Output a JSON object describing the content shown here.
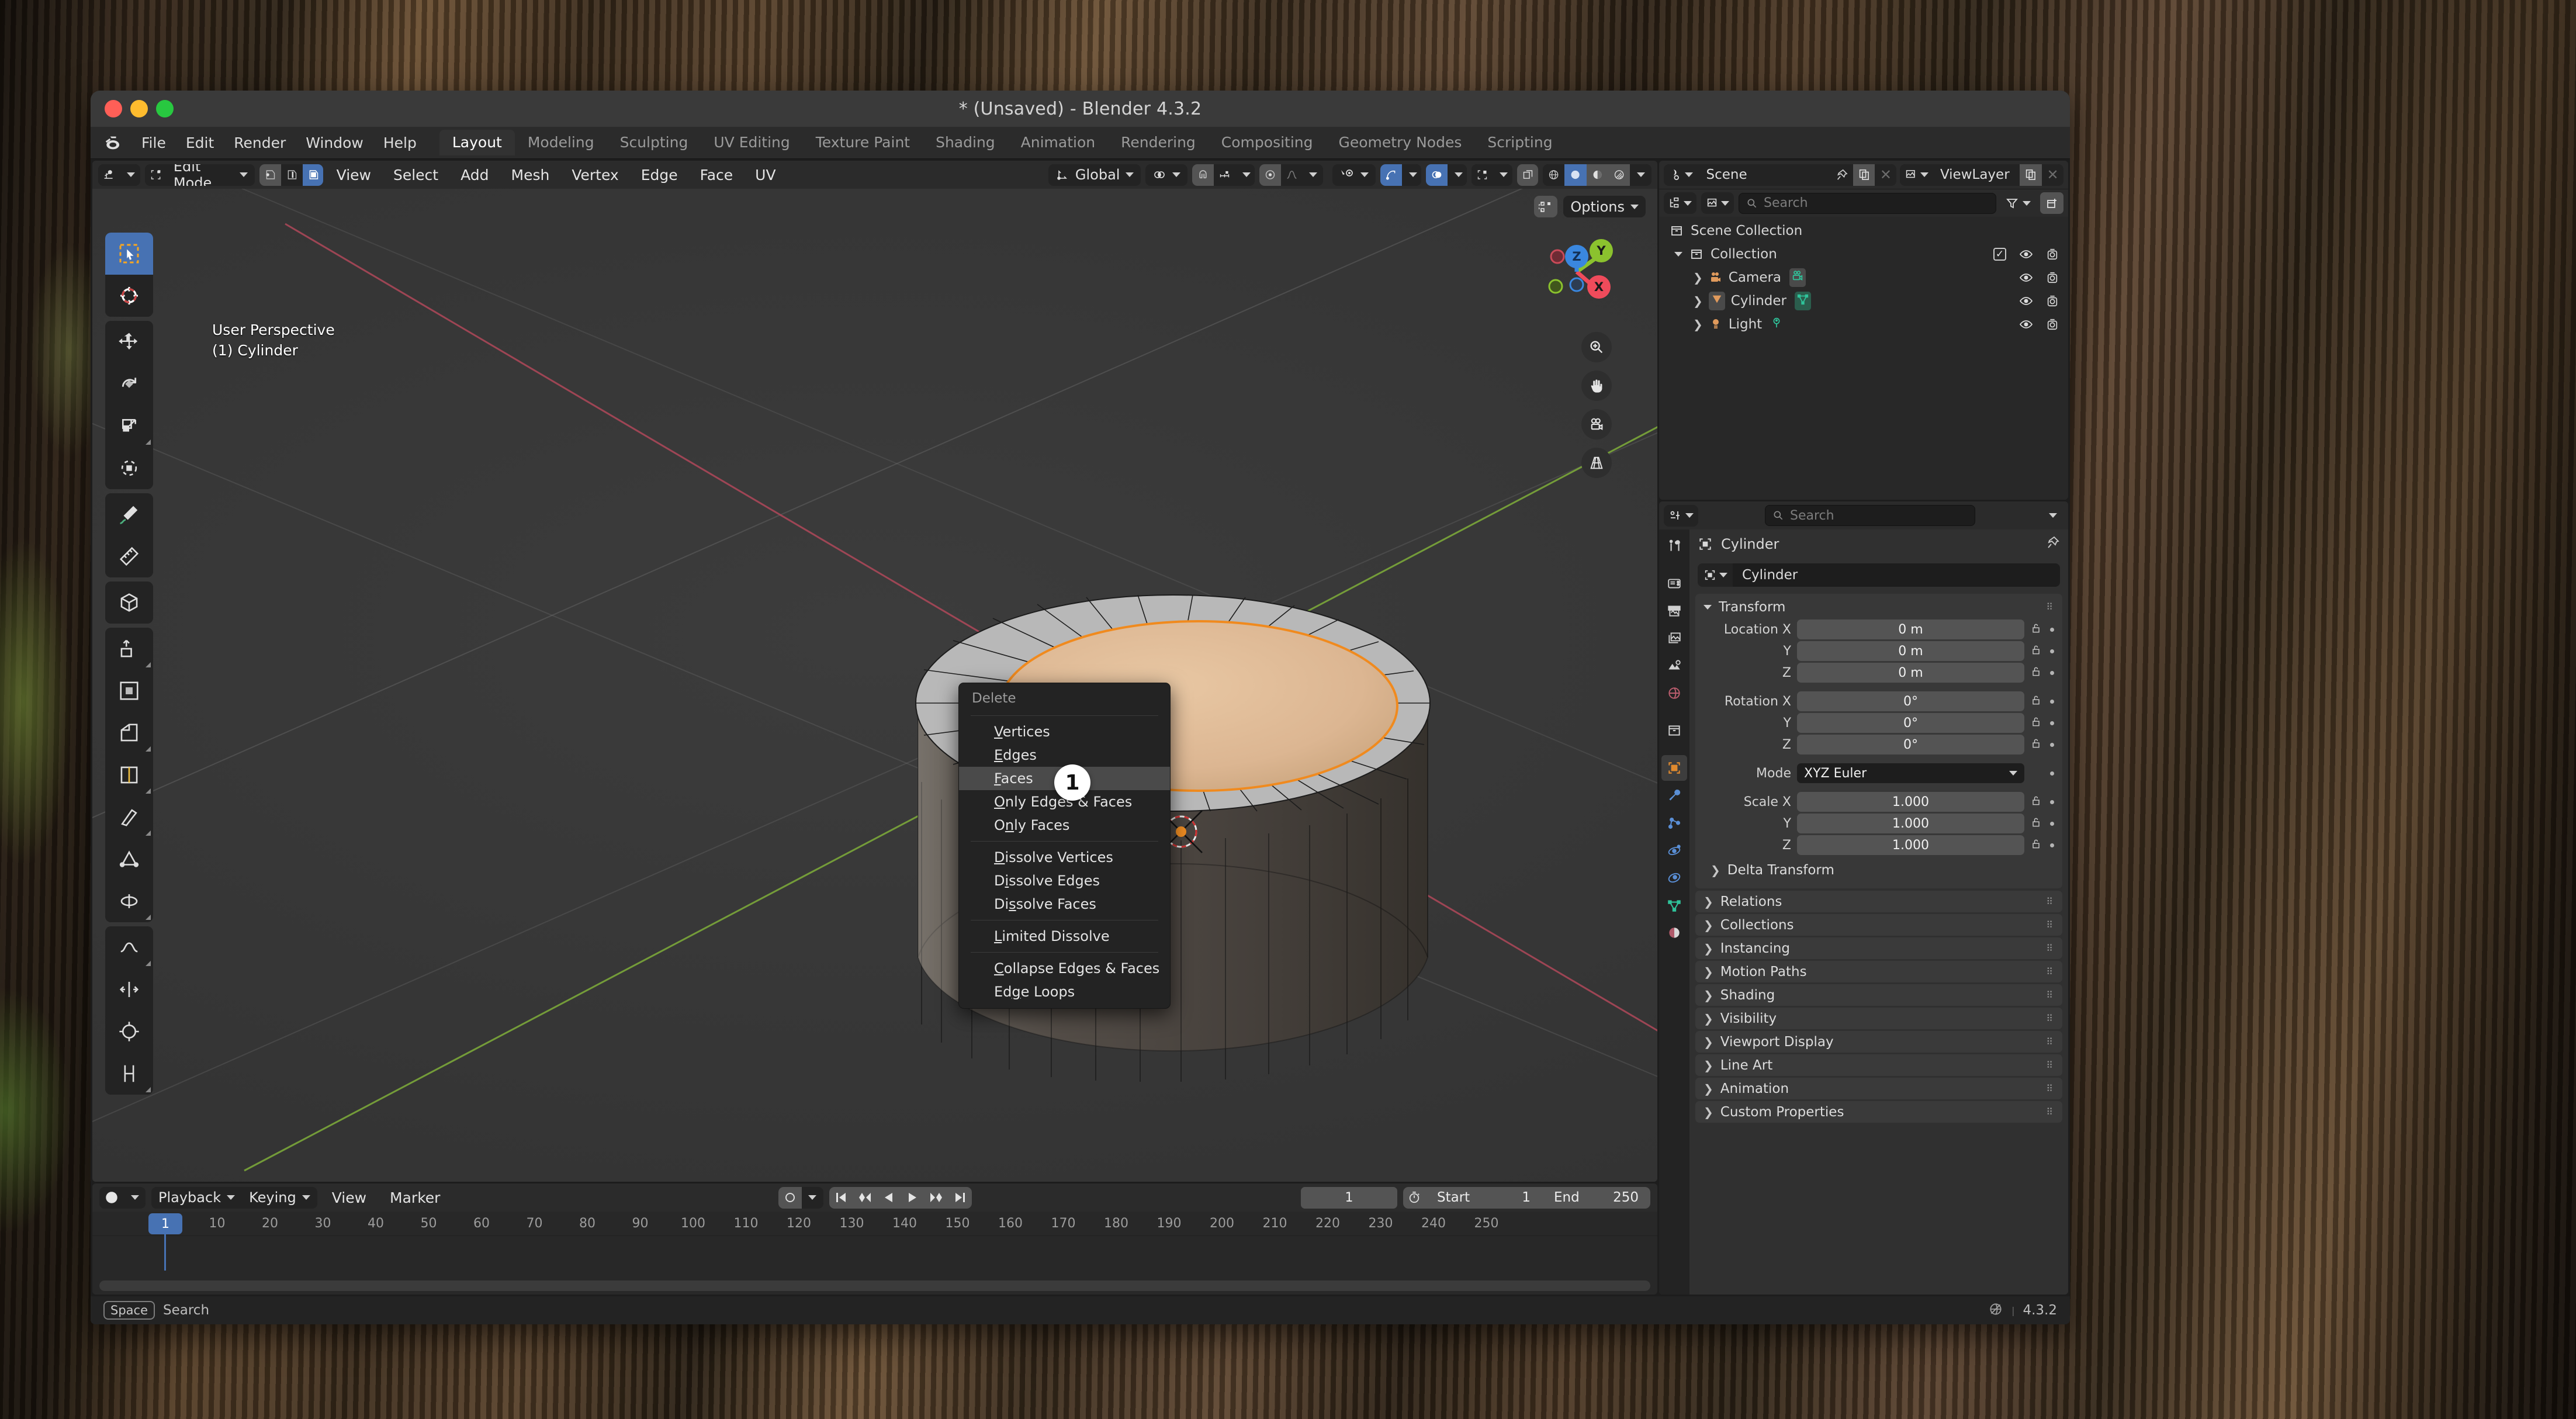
{
  "window": {
    "title": "* (Unsaved) - Blender 4.3.2",
    "traffic": {
      "close": "#ff5f57",
      "minimize": "#febc2e",
      "zoom": "#28c840"
    }
  },
  "topbar": {
    "logo": "blender-logo-icon",
    "menus": [
      "File",
      "Edit",
      "Render",
      "Window",
      "Help"
    ],
    "workspaces": [
      "Layout",
      "Modeling",
      "Sculpting",
      "UV Editing",
      "Texture Paint",
      "Shading",
      "Animation",
      "Rendering",
      "Compositing",
      "Geometry Nodes",
      "Scripting"
    ],
    "active_workspace": "Layout"
  },
  "viewport": {
    "editor_type_icon": "editor-type-3dview-icon",
    "mode": "Edit Mode",
    "select_modes": [
      "vertex-select-icon",
      "edge-select-icon",
      "face-select-icon"
    ],
    "active_select_mode": "face-select-icon",
    "menus": [
      "View",
      "Select",
      "Add",
      "Mesh",
      "Vertex",
      "Edge",
      "Face",
      "UV"
    ],
    "transform_orientation": "Global",
    "pivot_icon": "pivot-point-icon",
    "snap_icon": "magnet-icon",
    "snap_target_icon": "snap-increment-icon",
    "proportional_icon": "proportional-editing-icon",
    "falloff_icon": "smooth-falloff-icon",
    "options_label": "Options",
    "mesh_edit_mode_icon": "mesh-edit-options-icon",
    "overlay_line1": "User Perspective",
    "overlay_line2": "(1) Cylinder",
    "gizmo_axes": [
      {
        "label": "Z",
        "color": "#3a87df"
      },
      {
        "label": "Y",
        "color": "#8bc22e"
      },
      {
        "label": "X",
        "color": "#ef4b5b"
      }
    ],
    "nav_icons": [
      "zoom-icon",
      "pan-hand-icon",
      "camera-view-icon",
      "toggle-perspective-icon"
    ],
    "right_header_icons": [
      "visibility-selectability-icon",
      "gizmos-icon",
      "overlays-icon",
      "xray-toggle-icon",
      "shading-wireframe-icon",
      "shading-solid-icon",
      "shading-material-icon",
      "shading-rendered-icon"
    ],
    "toolbar_tools": [
      "tweak-select-box-icon",
      "cursor-icon",
      "move-icon",
      "rotate-icon",
      "scale-icon",
      "transform-icon",
      "annotate-icon",
      "measure-icon",
      "add-cube-icon",
      "extrude-region-icon",
      "inset-faces-icon",
      "bevel-icon",
      "loop-cut-icon",
      "knife-icon",
      "poly-build-icon",
      "spin-icon",
      "smooth-icon",
      "edge-slide-icon",
      "shrink-fatten-icon",
      "shear-icon",
      "rip-region-icon"
    ],
    "active_tool": "tweak-select-box-icon"
  },
  "delete_menu": {
    "title": "Delete",
    "highlighted": "Faces",
    "groups": [
      [
        {
          "label": "Vertices",
          "accel": "V"
        },
        {
          "label": "Edges",
          "accel": "E"
        },
        {
          "label": "Faces",
          "accel": "F"
        },
        {
          "label": "Only Edges & Faces",
          "accel": "O"
        },
        {
          "label": "Only Faces",
          "accel": "n"
        }
      ],
      [
        {
          "label": "Dissolve Vertices",
          "accel": "D"
        },
        {
          "label": "Dissolve Edges",
          "accel": "i"
        },
        {
          "label": "Dissolve Faces",
          "accel": "s"
        }
      ],
      [
        {
          "label": "Limited Dissolve",
          "accel": "L"
        }
      ],
      [
        {
          "label": "Collapse Edges & Faces",
          "accel": "C"
        },
        {
          "label": "Edge Loops",
          "accel": "g"
        }
      ]
    ],
    "step_badge": "1"
  },
  "outliner": {
    "scene_icon": "scene-icon",
    "scene_name": "Scene",
    "pin_icon": "pin-icon",
    "copy_icon": "new-scene-icon",
    "close_icon": "unlink-icon",
    "viewlayer_icon": "view-layer-icon",
    "viewlayer_name": "ViewLayer",
    "display_mode_icon": "outliner-display-mode-icon",
    "filter_icon": "filter-funnel-icon",
    "new_collection_icon": "new-collection-icon",
    "search_placeholder": "Search",
    "rows": [
      {
        "label": "Scene Collection",
        "icon": "collection-icon",
        "indent": 0,
        "expand": "",
        "checkbox": false,
        "eye": false,
        "camera": false
      },
      {
        "label": "Collection",
        "icon": "collection-icon",
        "indent": 1,
        "expand": "down",
        "checkbox": true,
        "eye": true,
        "camera": true
      },
      {
        "label": "Camera",
        "icon": "camera-data-icon",
        "indent": 2,
        "expand": "right",
        "data_icon": "camera-object-icon",
        "eye": true,
        "camera": true
      },
      {
        "label": "Cylinder",
        "icon": "mesh-object-icon",
        "indent": 2,
        "expand": "right",
        "data_icon": "mesh-data-icon",
        "eye": true,
        "camera": true
      },
      {
        "label": "Light",
        "icon": "light-object-icon",
        "indent": 2,
        "expand": "right",
        "data_icon": "light-data-icon",
        "eye": true,
        "camera": true
      }
    ]
  },
  "properties": {
    "editor_icon": "properties-editor-icon",
    "search_placeholder": "Search",
    "breadcrumb_icon": "object-properties-icon",
    "breadcrumb": "Cylinder",
    "pin_icon": "pin-icon",
    "name_field_icon": "object-properties-icon",
    "name_field_value": "Cylinder",
    "tabs": [
      "tool-icon",
      "render-icon",
      "output-icon",
      "view-layer-icon",
      "scene-icon",
      "world-icon",
      "collection-icon",
      "object-icon",
      "modifiers-icon",
      "particles-icon",
      "physics-icon",
      "object-constraints-icon",
      "object-data-icon",
      "material-icon"
    ],
    "active_tab": "object-icon",
    "transform": {
      "title": "Transform",
      "rows": [
        {
          "label": "Location X",
          "value": "0 m"
        },
        {
          "label": "Y",
          "value": "0 m"
        },
        {
          "label": "Z",
          "value": "0 m"
        },
        {
          "label": "Rotation X",
          "value": "0°"
        },
        {
          "label": "Y",
          "value": "0°"
        },
        {
          "label": "Z",
          "value": "0°"
        }
      ],
      "mode_label": "Mode",
      "mode_value": "XYZ Euler",
      "scale_rows": [
        {
          "label": "Scale X",
          "value": "1.000"
        },
        {
          "label": "Y",
          "value": "1.000"
        },
        {
          "label": "Z",
          "value": "1.000"
        }
      ]
    },
    "closed_panels": [
      "Delta Transform",
      "Relations",
      "Collections",
      "Instancing",
      "Motion Paths",
      "Shading",
      "Visibility",
      "Viewport Display",
      "Line Art",
      "Animation",
      "Custom Properties"
    ]
  },
  "timeline": {
    "editor_icon": "timeline-editor-icon",
    "menus": [
      "Playback",
      "Keying",
      "View",
      "Marker"
    ],
    "auto_key_icon": "record-icon",
    "transport": [
      "jump-to-start-icon",
      "jump-to-prev-keyframe-icon",
      "play-reverse-icon",
      "play-icon",
      "jump-to-next-keyframe-icon",
      "jump-to-end-icon"
    ],
    "current_frame": "1",
    "timer_icon": "stopwatch-icon",
    "start_label": "Start",
    "start_value": "1",
    "end_label": "End",
    "end_value": "250",
    "ticks": [
      "10",
      "20",
      "30",
      "40",
      "50",
      "60",
      "70",
      "80",
      "90",
      "100",
      "110",
      "120",
      "130",
      "140",
      "150",
      "160",
      "170",
      "180",
      "190",
      "200",
      "210",
      "220",
      "230",
      "240",
      "250"
    ],
    "playhead_label": "1"
  },
  "statusbar": {
    "key_hint": "Space",
    "key_action": "Search",
    "network_icon": "no-network-icon",
    "version": "4.3.2"
  },
  "colors": {
    "accent_blue": "#4772b3",
    "panel_bg": "#303030",
    "header_bg": "#2b2b2b",
    "dark_bg": "#1d1d1d",
    "text": "#dcdcdc",
    "mesh_orange": "#e8b07a",
    "face_dot_orange": "#ee8c22"
  }
}
